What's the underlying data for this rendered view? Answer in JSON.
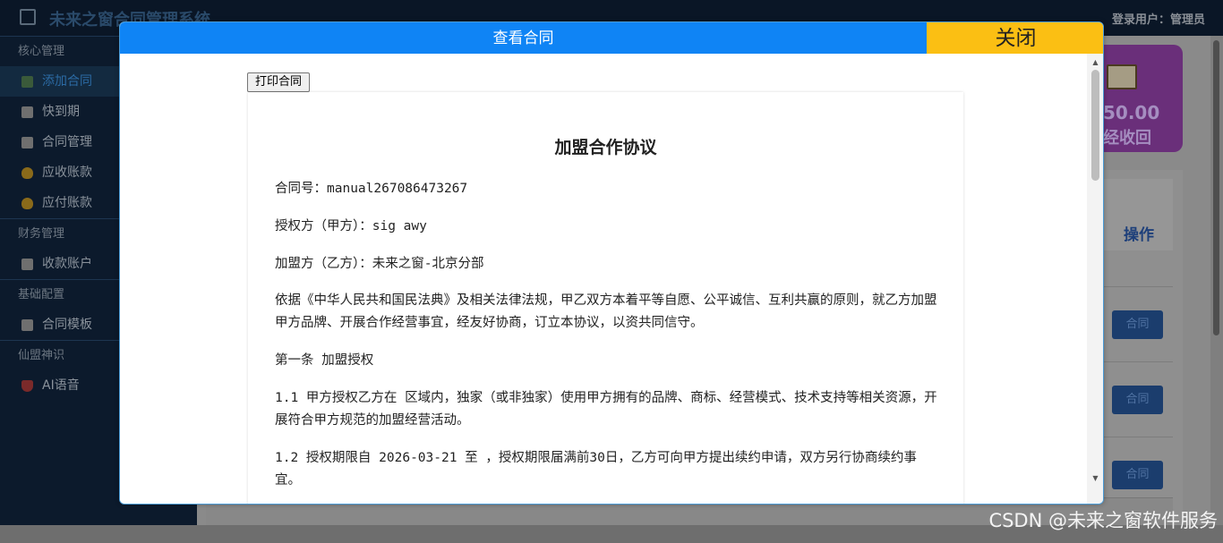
{
  "app": {
    "title": "未来之窗合同管理系统",
    "login_user": "登录用户：管理员"
  },
  "sidebar": {
    "groups": [
      {
        "label": "核心管理",
        "items": [
          {
            "label": "添加合同",
            "icon": "chart-icon",
            "active": true
          },
          {
            "label": "快到期",
            "icon": "doc-icon"
          },
          {
            "label": "合同管理",
            "icon": "doc-icon"
          },
          {
            "label": "应收账款",
            "icon": "money-bag-icon"
          },
          {
            "label": "应付账款",
            "icon": "money-bag-icon"
          }
        ]
      },
      {
        "label": "财务管理",
        "items": [
          {
            "label": "收款账户",
            "icon": "doc-icon"
          }
        ]
      },
      {
        "label": "基础配置",
        "items": [
          {
            "label": "合同模板",
            "icon": "doc-icon"
          }
        ]
      },
      {
        "label": "仙盟神识",
        "items": [
          {
            "label": "AI语音",
            "icon": "shield-icon"
          }
        ]
      }
    ]
  },
  "stat_card": {
    "value": "50.00",
    "label": "经收回"
  },
  "table": {
    "op_header": "操作",
    "row_buttons": [
      "合同",
      "合同",
      "合同"
    ]
  },
  "modal": {
    "title": "查看合同",
    "close_label": "关闭",
    "print_label": "打印合同",
    "scroll_up": "▲",
    "scroll_down": "▼"
  },
  "document": {
    "title": "加盟合作协议",
    "paragraphs": [
      "合同号：manual267086473267",
      "授权方（甲方）：sig awy",
      "加盟方（乙方）：未来之窗-北京分部",
      "依据《中华人民共和国民法典》及相关法律法规，甲乙双方本着平等自愿、公平诚信、互利共赢的原则，就乙方加盟甲方品牌、开展合作经营事宜，经友好协商，订立本协议，以资共同信守。",
      "第一条 加盟授权",
      "1.1 甲方授权乙方在 区域内，独家（或非独家）使用甲方拥有的品牌、商标、经营模式、技术支持等相关资源，开展符合甲方规范的加盟经营活动。",
      "1.2 授权期限自 2026-03-21 至 ，授权期限届满前30日，乙方可向甲方提出续约申请，双方另行协商续约事宜。"
    ]
  },
  "watermark": "CSDN @未来之窗软件服务",
  "colors": {
    "modal_title_bg": "#0f84f5",
    "close_bg": "#fbbf13",
    "stat_card_bg": "#6a2f7a"
  }
}
